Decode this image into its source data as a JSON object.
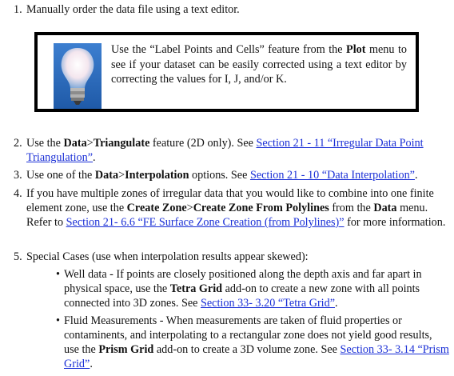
{
  "items": [
    {
      "number": "1.",
      "text": "Manually order the data file using a text editor."
    },
    {
      "number": "2.",
      "a": "Use the ",
      "b1": "Data",
      "b2": ">",
      "b3": "Triangulate",
      "c": " feature (2D only). See ",
      "link": "Section 21 - 11 “Irregular Data Point Triangulation”",
      "d": "."
    },
    {
      "number": "3.",
      "a": "Use one of the ",
      "b1": "Data",
      "b2": ">",
      "b3": "Interpolation",
      "c": " options. See ",
      "link": "Section 21 - 10 “Data Interpolation”",
      "d": "."
    },
    {
      "number": "4.",
      "a": "If you have multiple zones of irregular data that you would like to combine into one finite element zone, use the ",
      "b1": "Create Zone",
      "b2": ">",
      "b3": "Create Zone From Polylines",
      "c": " from the ",
      "b4": "Data",
      "d": " menu. Refer to ",
      "link": "Section 21- 6.6 “FE Surface Zone Creation (from Polylines)”",
      "e": " for more information."
    },
    {
      "number": "5.",
      "text": "Special Cases (use when interpolation results appear skewed):"
    }
  ],
  "tip": {
    "a": "Use the “Label Points and Cells” feature from the ",
    "bold": "Plot",
    "b": " menu to see if your dataset can be easily corrected using a text editor by correcting the values for I, J, and/or K."
  },
  "bullets": [
    {
      "symbol": "•",
      "a": "Well data - If points are closely positioned along the depth axis and far apart in physical space, use the ",
      "bold": "Tetra Grid",
      "b": " add-on to create a new zone with all points connected into 3D zones. See ",
      "link": "Section 33- 3.20 “Tetra Grid”",
      "c": "."
    },
    {
      "symbol": "•",
      "a": "Fluid Measurements - When measurements are taken of fluid properties or contaminents, and interpolating to a rectangular zone does not yield good results, use the ",
      "bold": "Prism Grid",
      "b": " add-on to create a 3D volume zone. See ",
      "link": "Section 33- 3.14 “Prism Grid”",
      "c": "."
    }
  ],
  "icon": "lightbulb-icon"
}
